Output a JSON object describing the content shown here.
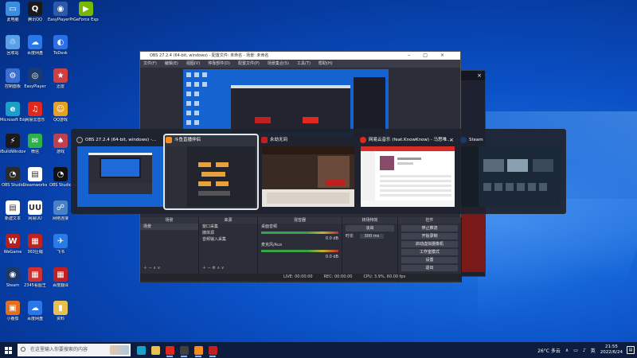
{
  "desktop_icons": [
    {
      "label": "此电脑",
      "color": "#3a8fe0",
      "glyph": "▭"
    },
    {
      "label": "腾讯QQ",
      "color": "#1a1a1a",
      "glyph": "Q"
    },
    {
      "label": "EasyPlayerPr",
      "color": "#2d5aa8",
      "glyph": "◉"
    },
    {
      "label": "GeForce Experience",
      "color": "#76b900",
      "glyph": "▶"
    },
    {
      "label": "回收站",
      "color": "#5aa0e6",
      "glyph": "♲"
    },
    {
      "label": "百度网盘",
      "color": "#2a77e8",
      "glyph": "☁"
    },
    {
      "label": "ToDesk",
      "color": "#2b6fe8",
      "glyph": "◐"
    },
    {
      "label": "控制面板",
      "color": "#3a6ed0",
      "glyph": "⚙"
    },
    {
      "label": "EasyPlayer",
      "color": "#1a3b70",
      "glyph": "◎"
    },
    {
      "label": "迅雷",
      "color": "#d04040",
      "glyph": "★"
    },
    {
      "label": "Microsoft Edge",
      "color": "#1aa0c8",
      "glyph": "e"
    },
    {
      "label": "网易云音乐",
      "color": "#e0281e",
      "glyph": "♫"
    },
    {
      "label": "QQ游戏",
      "color": "#e8a020",
      "glyph": "☺"
    },
    {
      "label": "iBuildWindows",
      "color": "#1a1a1a",
      "glyph": "⚡"
    },
    {
      "label": "微信",
      "color": "#2bb34b",
      "glyph": "✉"
    },
    {
      "label": "游戏",
      "color": "#c04050",
      "glyph": "♠"
    },
    {
      "label": "OBS Studio",
      "color": "#2a2a2a",
      "glyph": "◔"
    },
    {
      "label": "Steamworks",
      "color": "#ffffff",
      "glyph": "▤"
    },
    {
      "label": "OBS Studio",
      "color": "#111111",
      "glyph": "◔"
    },
    {
      "label": "Internet Explorer",
      "color": "#1f82d8",
      "glyph": "e"
    },
    {
      "label": "新建文本",
      "color": "#ffffff",
      "glyph": "▤"
    },
    {
      "label": "网易UU",
      "color": "#ffffff",
      "glyph": "UU"
    },
    {
      "label": "网络连接",
      "color": "#4a80c8",
      "glyph": "☍"
    },
    {
      "label": "WeGame",
      "color": "#b02020",
      "glyph": "W"
    },
    {
      "label": "360压缩",
      "color": "#c02020",
      "glyph": "▦"
    },
    {
      "label": "飞书",
      "color": "#2a7ae8",
      "glyph": "✈"
    },
    {
      "label": "Steam",
      "color": "#1b3a6a",
      "glyph": "◉"
    },
    {
      "label": "2345看图王",
      "color": "#d03030",
      "glyph": "▦"
    },
    {
      "label": "百度翻译",
      "color": "#c02020",
      "glyph": "▦"
    },
    {
      "label": "小番茄",
      "color": "#e07020",
      "glyph": "▣"
    },
    {
      "label": "百度网盘",
      "color": "#2a77e8",
      "glyph": "☁"
    },
    {
      "label": "资料",
      "color": "#e8c050",
      "glyph": "▮"
    }
  ],
  "obs_window": {
    "title": "OBS 27.2.4 (64-bit, windows) - 配置文件: 未命名 - 场景: 未命名",
    "menu": [
      "文件(F)",
      "编辑(E)",
      "视图(V)",
      "停靠部件(D)",
      "配置文件(P)",
      "场景集合(S)",
      "工具(T)",
      "帮助(H)"
    ],
    "docks": {
      "scenes": {
        "header": "场景",
        "items": [
          "场景"
        ]
      },
      "sources": {
        "header": "来源",
        "items": [
          "窗口采集",
          "媒体源",
          "音频输入采集"
        ]
      },
      "mixer": {
        "header": "混音器",
        "tracks": [
          {
            "name": "桌面音频",
            "db": "0.0 dB"
          },
          {
            "name": "麦克风/Aux",
            "db": "0.0 dB"
          }
        ]
      },
      "transitions": {
        "header": "转场特效",
        "type": "淡出",
        "duration_label": "时长",
        "duration": "300 ms"
      },
      "controls": {
        "header": "控件",
        "buttons": [
          "停止推流",
          "开始录制",
          "启动虚拟摄像机",
          "工作室模式",
          "设置",
          "退出"
        ]
      }
    },
    "status": [
      "LIVE: 00:00:00",
      "REC: 00:00:00",
      "CPU: 3.9%, 60.00 fps"
    ]
  },
  "switcher": {
    "cards": [
      {
        "title": "OBS 27.2.4 (64-bit, windows) -...",
        "icon_color": "#2a2a2a",
        "selected": false
      },
      {
        "title": "斗鱼直播伴侣",
        "icon_color": "#f28c1e",
        "selected": true
      },
      {
        "title": "永劫无间",
        "icon_color": "#c02020",
        "selected": false
      },
      {
        "title": "网易云音乐 (feat.KnowKnow) - 马思唯...",
        "icon_color": "#e0281e",
        "selected": false
      },
      {
        "title": "Steam",
        "icon_color": "#1b3a6a",
        "selected": false
      }
    ],
    "close_glyph": "×"
  },
  "taskbar": {
    "search_placeholder": "在这里输入你要搜索的内容",
    "apps": [
      {
        "name": "edge",
        "color": "#1aa0c8",
        "active": false
      },
      {
        "name": "file-explorer",
        "color": "#e8c050",
        "active": false
      },
      {
        "name": "netease-music",
        "color": "#e0281e",
        "active": true
      },
      {
        "name": "obs",
        "color": "#404040",
        "active": true
      },
      {
        "name": "douyu",
        "color": "#f28c1e",
        "active": true
      },
      {
        "name": "naraka",
        "color": "#c02020",
        "active": true
      }
    ],
    "weather": "26°C 多云",
    "lang": "英",
    "time": "21:55",
    "date": "2022/6/24"
  }
}
